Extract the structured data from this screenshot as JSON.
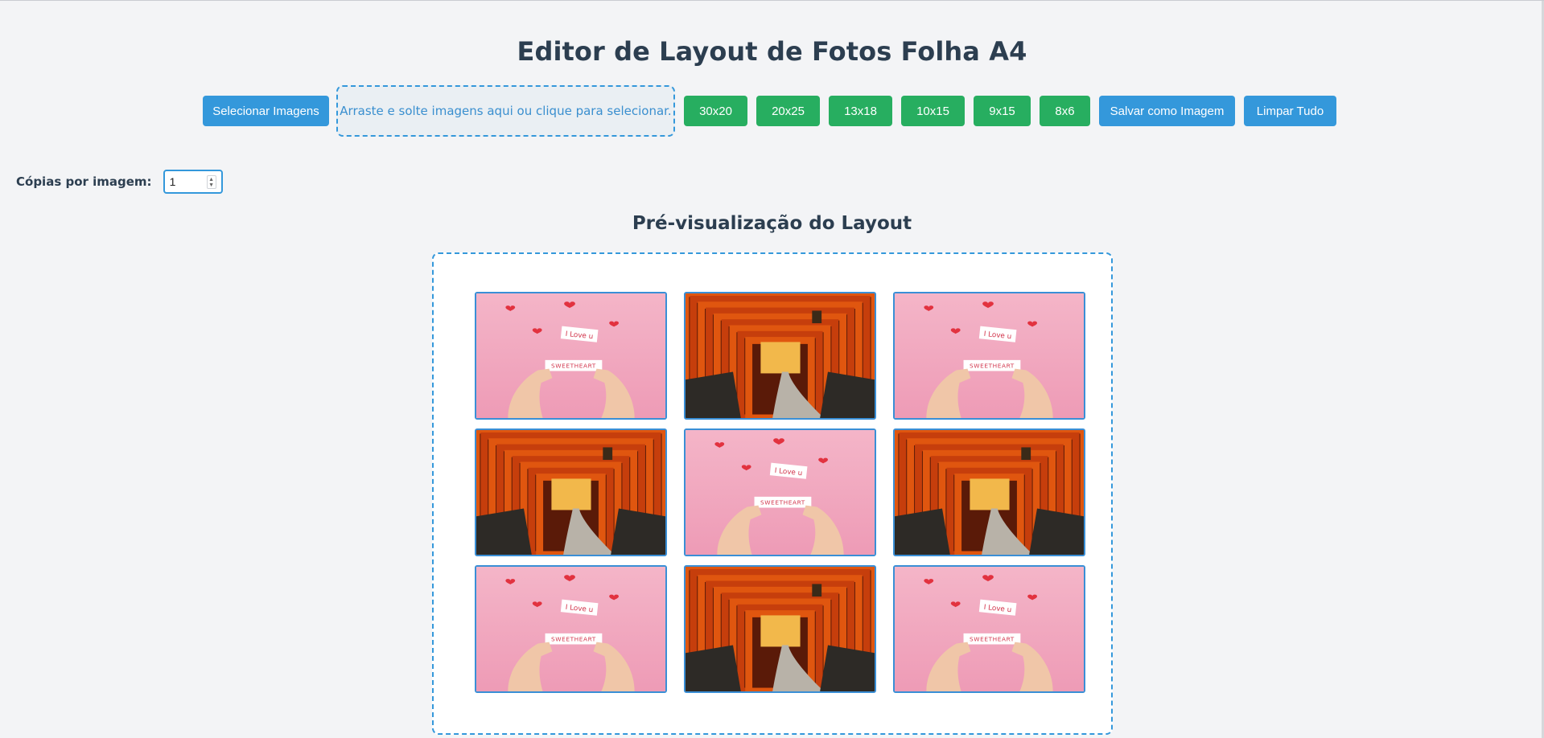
{
  "page": {
    "title": "Editor de Layout de Fotos Folha A4",
    "preview_title": "Pré-visualização do Layout"
  },
  "toolbar": {
    "select_images": "Selecionar Imagens",
    "dropzone_text": "Arraste e solte imagens aqui ou clique para selecionar.",
    "sizes": [
      "30x20",
      "20x25",
      "13x18",
      "10x15",
      "9x15",
      "8x6"
    ],
    "save_image": "Salvar como Imagem",
    "clear_all": "Limpar Tudo"
  },
  "copies": {
    "label": "Cópias por imagem:",
    "value": "1"
  },
  "photos": [
    {
      "kind": "hearts-photo",
      "note": "I Love u",
      "banner": "SWEETHEART"
    },
    {
      "kind": "torii-photo"
    },
    {
      "kind": "hearts-photo",
      "note": "I Love u",
      "banner": "SWEETHEART"
    },
    {
      "kind": "torii-photo"
    },
    {
      "kind": "hearts-photo",
      "note": "I Love u",
      "banner": "SWEETHEART"
    },
    {
      "kind": "torii-photo"
    },
    {
      "kind": "hearts-photo",
      "note": "I Love u",
      "banner": "SWEETHEART"
    },
    {
      "kind": "torii-photo"
    },
    {
      "kind": "hearts-photo",
      "note": "I Love u",
      "banner": "SWEETHEART"
    }
  ],
  "colors": {
    "primary": "#3498db",
    "success": "#27ae60",
    "heading": "#2c3e50"
  }
}
